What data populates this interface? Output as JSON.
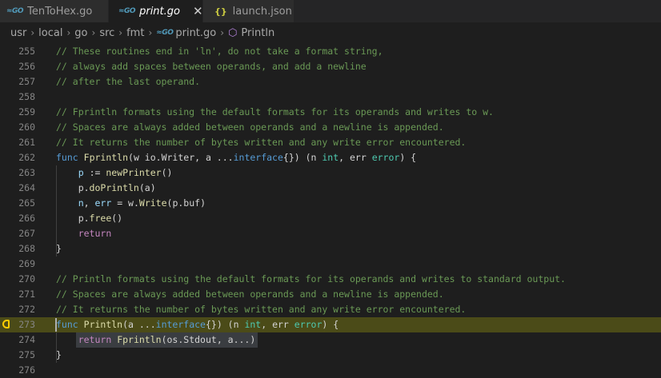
{
  "tabs": [
    {
      "icon": "GO",
      "label": "TenToHex.go",
      "active": false
    },
    {
      "icon": "GO",
      "label": "print.go",
      "active": true,
      "close": "✕"
    },
    {
      "icon": "{}",
      "label": "launch.json",
      "active": false
    }
  ],
  "breadcrumb": {
    "items": [
      "usr",
      "local",
      "go",
      "src",
      "fmt",
      "print.go",
      "Println"
    ],
    "separator": "›"
  },
  "colors": {
    "comment": "#6a9955",
    "keyword": "#569cd6",
    "function": "#dcdcaa",
    "variable": "#9cdcfe",
    "type": "#4ec9b0",
    "plain": "#d4d4d4",
    "control": "#c586c0",
    "highlight": "#4b4b18",
    "breakpoint": "#ffcc00"
  },
  "editor": {
    "lines": [
      {
        "num": "255",
        "tokens": [
          [
            "// These routines end in 'ln', do not take a format string,",
            "comment"
          ]
        ]
      },
      {
        "num": "256",
        "tokens": [
          [
            "// always add spaces between operands, and add a newline",
            "comment"
          ]
        ]
      },
      {
        "num": "257",
        "tokens": [
          [
            "// after the last operand.",
            "comment"
          ]
        ]
      },
      {
        "num": "258",
        "tokens": []
      },
      {
        "num": "259",
        "tokens": [
          [
            "// Fprintln formats using the default formats for its operands and writes to w.",
            "comment"
          ]
        ]
      },
      {
        "num": "260",
        "tokens": [
          [
            "// Spaces are always added between operands and a newline is appended.",
            "comment"
          ]
        ]
      },
      {
        "num": "261",
        "tokens": [
          [
            "// It returns the number of bytes written and any write error encountered.",
            "comment"
          ]
        ]
      },
      {
        "num": "262",
        "tokens": [
          [
            "func",
            "keyword"
          ],
          [
            " ",
            "plain"
          ],
          [
            "Fprintln",
            "function"
          ],
          [
            "(w io.Writer, a ...",
            "plain"
          ],
          [
            "interface",
            "keyword"
          ],
          [
            "{}) (n ",
            "plain"
          ],
          [
            "int",
            "type"
          ],
          [
            ", err ",
            "plain"
          ],
          [
            "error",
            "type"
          ],
          [
            ") {",
            "plain"
          ]
        ]
      },
      {
        "num": "263",
        "tokens": [
          [
            "    ",
            "plain"
          ],
          [
            "p",
            "variable"
          ],
          [
            " := ",
            "plain"
          ],
          [
            "newPrinter",
            "function"
          ],
          [
            "()",
            "plain"
          ]
        ]
      },
      {
        "num": "264",
        "tokens": [
          [
            "    p.",
            "plain"
          ],
          [
            "doPrintln",
            "function"
          ],
          [
            "(a)",
            "plain"
          ]
        ]
      },
      {
        "num": "265",
        "tokens": [
          [
            "    ",
            "plain"
          ],
          [
            "n",
            "variable"
          ],
          [
            ", ",
            "plain"
          ],
          [
            "err",
            "variable"
          ],
          [
            " = w.",
            "plain"
          ],
          [
            "Write",
            "function"
          ],
          [
            "(p.buf)",
            "plain"
          ]
        ]
      },
      {
        "num": "266",
        "tokens": [
          [
            "    p.",
            "plain"
          ],
          [
            "free",
            "function"
          ],
          [
            "()",
            "plain"
          ]
        ]
      },
      {
        "num": "267",
        "tokens": [
          [
            "    ",
            "plain"
          ],
          [
            "return",
            "control"
          ]
        ]
      },
      {
        "num": "268",
        "tokens": [
          [
            "}",
            "plain"
          ]
        ]
      },
      {
        "num": "269",
        "tokens": []
      },
      {
        "num": "270",
        "tokens": [
          [
            "// Println formats using the default formats for its operands and writes to standard output.",
            "comment"
          ]
        ]
      },
      {
        "num": "271",
        "tokens": [
          [
            "// Spaces are always added between operands and a newline is appended.",
            "comment"
          ]
        ]
      },
      {
        "num": "272",
        "tokens": [
          [
            "// It returns the number of bytes written and any write error encountered.",
            "comment"
          ]
        ]
      },
      {
        "num": "273",
        "tokens": [
          [
            "func",
            "keyword"
          ],
          [
            " ",
            "plain"
          ],
          [
            "Println",
            "function"
          ],
          [
            "(a ...",
            "plain"
          ],
          [
            "interface",
            "keyword"
          ],
          [
            "{}) (n ",
            "plain"
          ],
          [
            "int",
            "type"
          ],
          [
            ", err ",
            "plain"
          ],
          [
            "error",
            "type"
          ],
          [
            ") {",
            "plain"
          ]
        ],
        "current": true,
        "breakpoint": true
      },
      {
        "num": "274",
        "tokens": [
          [
            "    ",
            "plain"
          ],
          [
            "return",
            "control"
          ],
          [
            " ",
            "plain"
          ],
          [
            "Fprintln",
            "function"
          ],
          [
            "(os.Stdout, a...)",
            "plain"
          ]
        ],
        "selected": true
      },
      {
        "num": "275",
        "tokens": [
          [
            "}",
            "plain"
          ]
        ]
      },
      {
        "num": "276",
        "tokens": []
      }
    ]
  }
}
